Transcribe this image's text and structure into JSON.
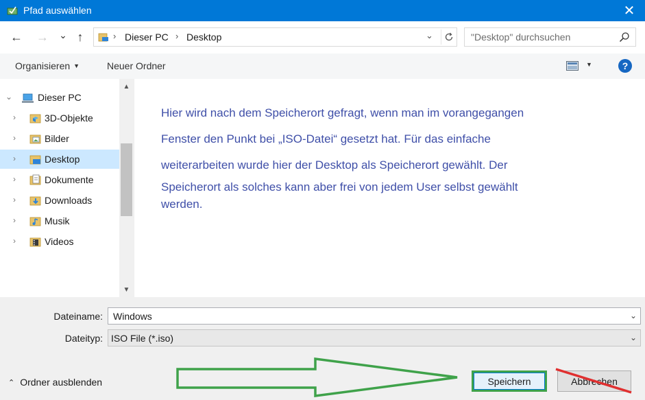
{
  "window": {
    "title": "Pfad auswählen",
    "close_glyph": "✕"
  },
  "nav": {
    "back_glyph": "←",
    "forward_glyph": "→",
    "recent_glyph": "⌄",
    "up_glyph": "↑"
  },
  "address": {
    "crumbs": [
      "Dieser PC",
      "Desktop"
    ],
    "separator": "›",
    "dropdown_glyph": "⌄"
  },
  "search": {
    "placeholder": "\"Desktop\" durchsuchen"
  },
  "toolbar": {
    "organize_label": "Organisieren",
    "new_folder_label": "Neuer Ordner",
    "caret": "▼",
    "help_glyph": "?"
  },
  "tree": {
    "root": "Dieser PC",
    "items": [
      {
        "label": "3D-Objekte"
      },
      {
        "label": "Bilder"
      },
      {
        "label": "Desktop"
      },
      {
        "label": "Dokumente"
      },
      {
        "label": "Downloads"
      },
      {
        "label": "Musik"
      },
      {
        "label": "Videos"
      }
    ],
    "selected": "Desktop",
    "chevron_collapsed": "›",
    "chevron_expanded": "⌄"
  },
  "annotation": {
    "lines": [
      "Hier wird nach dem Speicherort gefragt, wenn man im vorangegangen",
      "Fenster den Punkt bei „ISO-Datei“ gesetzt hat. Für das einfache",
      "weiterarbeiten wurde hier der Desktop als Speicherort gewählt. Der",
      "Speicherort als solches kann aber frei von jedem User selbst gewählt",
      "werden."
    ]
  },
  "form": {
    "filename_label": "Dateiname:",
    "filename_value": "Windows",
    "filetype_label": "Dateityp:",
    "filetype_value": "ISO File (*.iso)",
    "dropdown_glyph": "⌄"
  },
  "footer": {
    "hide_folders_label": "Ordner ausblenden",
    "hide_chevron": "⌃",
    "save_label": "Speichern",
    "cancel_label": "Abbrechen"
  },
  "colors": {
    "titlebar": "#0078d7",
    "annotation_text": "#3f4fa8",
    "arrow_green": "#3fa24a",
    "strike_red": "#e03030",
    "selected_bg": "#cce8ff"
  }
}
